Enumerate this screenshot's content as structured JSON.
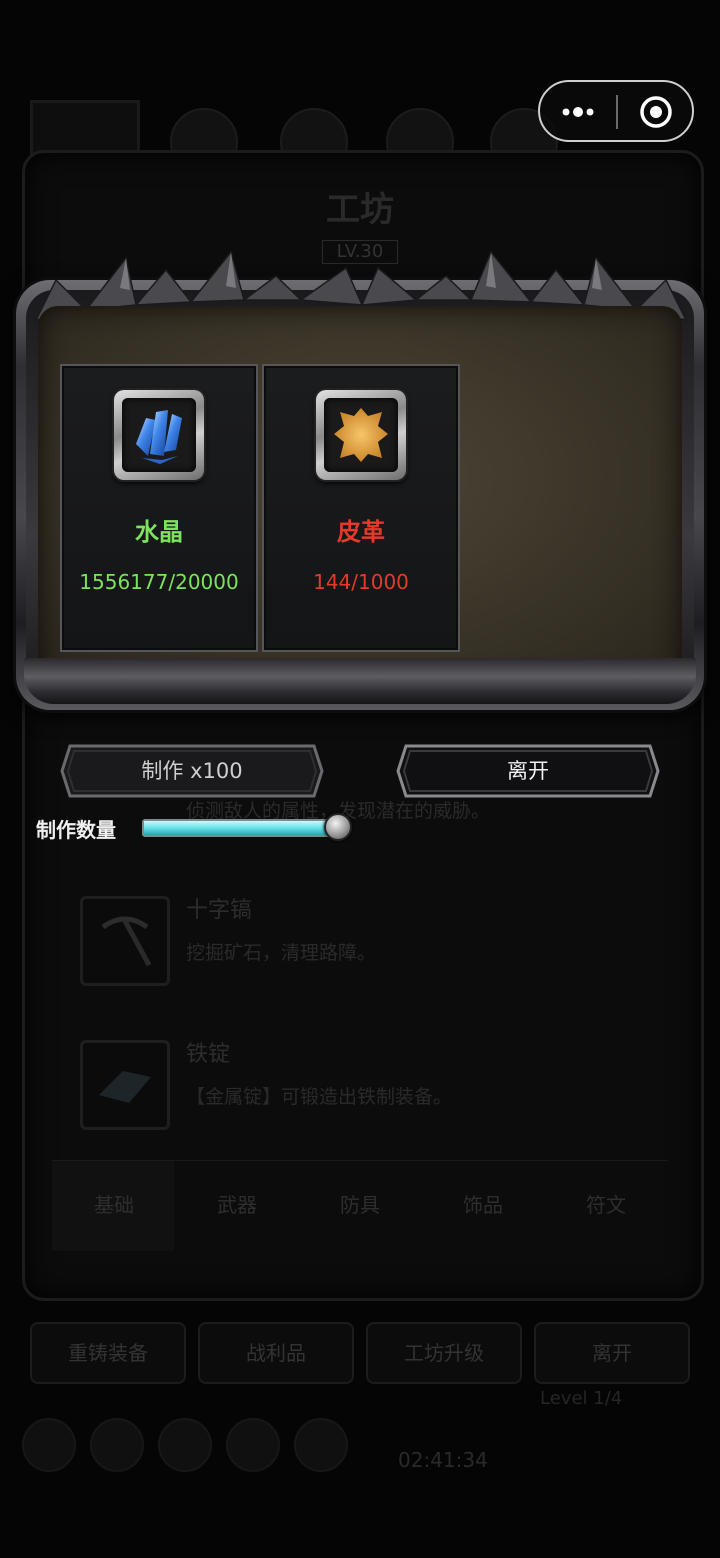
{
  "background": {
    "title": "工坊",
    "level": "LV.30",
    "partial_text": "侦测敌人的属性，发现潜在的威胁。",
    "items": [
      {
        "name": "十字镐",
        "desc": "挖掘矿石，清理路障。",
        "icon": "pickaxe-icon"
      },
      {
        "name": "铁锭",
        "desc": "【金属锭】可锻造出铁制装备。",
        "icon": "iron-ingot-icon"
      }
    ],
    "tabs": [
      "基础",
      "武器",
      "防具",
      "饰品",
      "符文"
    ],
    "selected_tab": "基础",
    "buttons": [
      "重铸装备",
      "战利品",
      "工坊升级",
      "离开"
    ],
    "timer": "02:41:34",
    "small_text": "Level 1/4"
  },
  "dialog": {
    "materials": [
      {
        "name": "水晶",
        "count": "1556177/20000",
        "icon": "crystal-icon",
        "color": "#7ee35c"
      },
      {
        "name": "皮革",
        "count": "144/1000",
        "icon": "leather-hide-icon",
        "color": "#e23b2a"
      }
    ],
    "craft_button": "制作 x100",
    "leave_button": "离开",
    "quantity_label": "制作数量",
    "quantity_slider": {
      "value": 1.0
    }
  },
  "colors": {
    "sufficient": "#7ee35c",
    "insufficient": "#e23b2a",
    "slider": "#5fdde4"
  },
  "capsule": {
    "more_icon": "more-dots-icon",
    "close_icon": "mini-program-close-icon"
  }
}
